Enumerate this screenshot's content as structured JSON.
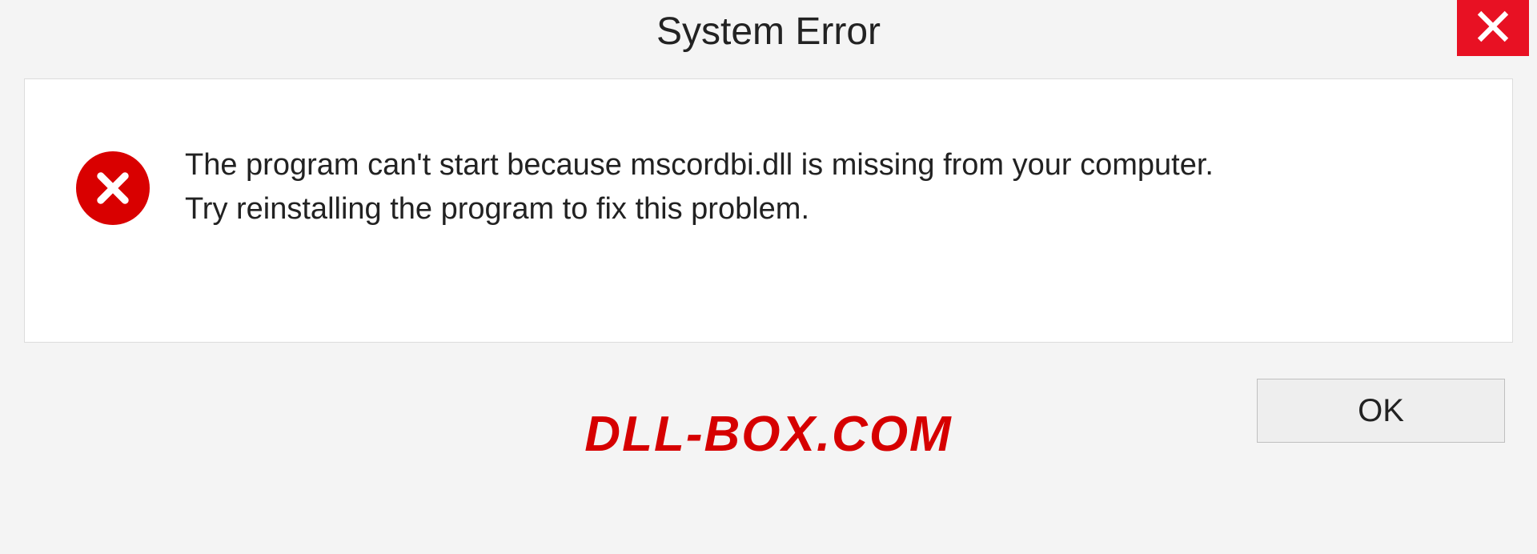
{
  "dialog": {
    "title": "System Error",
    "close_label": "Close",
    "message_line1": "The program can't start because mscordbi.dll is missing from your computer.",
    "message_line2": "Try reinstalling the program to fix this problem.",
    "ok_label": "OK"
  },
  "watermark": {
    "text": "DLL-BOX.COM"
  },
  "colors": {
    "close_bg": "#e81123",
    "error_icon": "#d90000",
    "watermark": "#d60000"
  }
}
